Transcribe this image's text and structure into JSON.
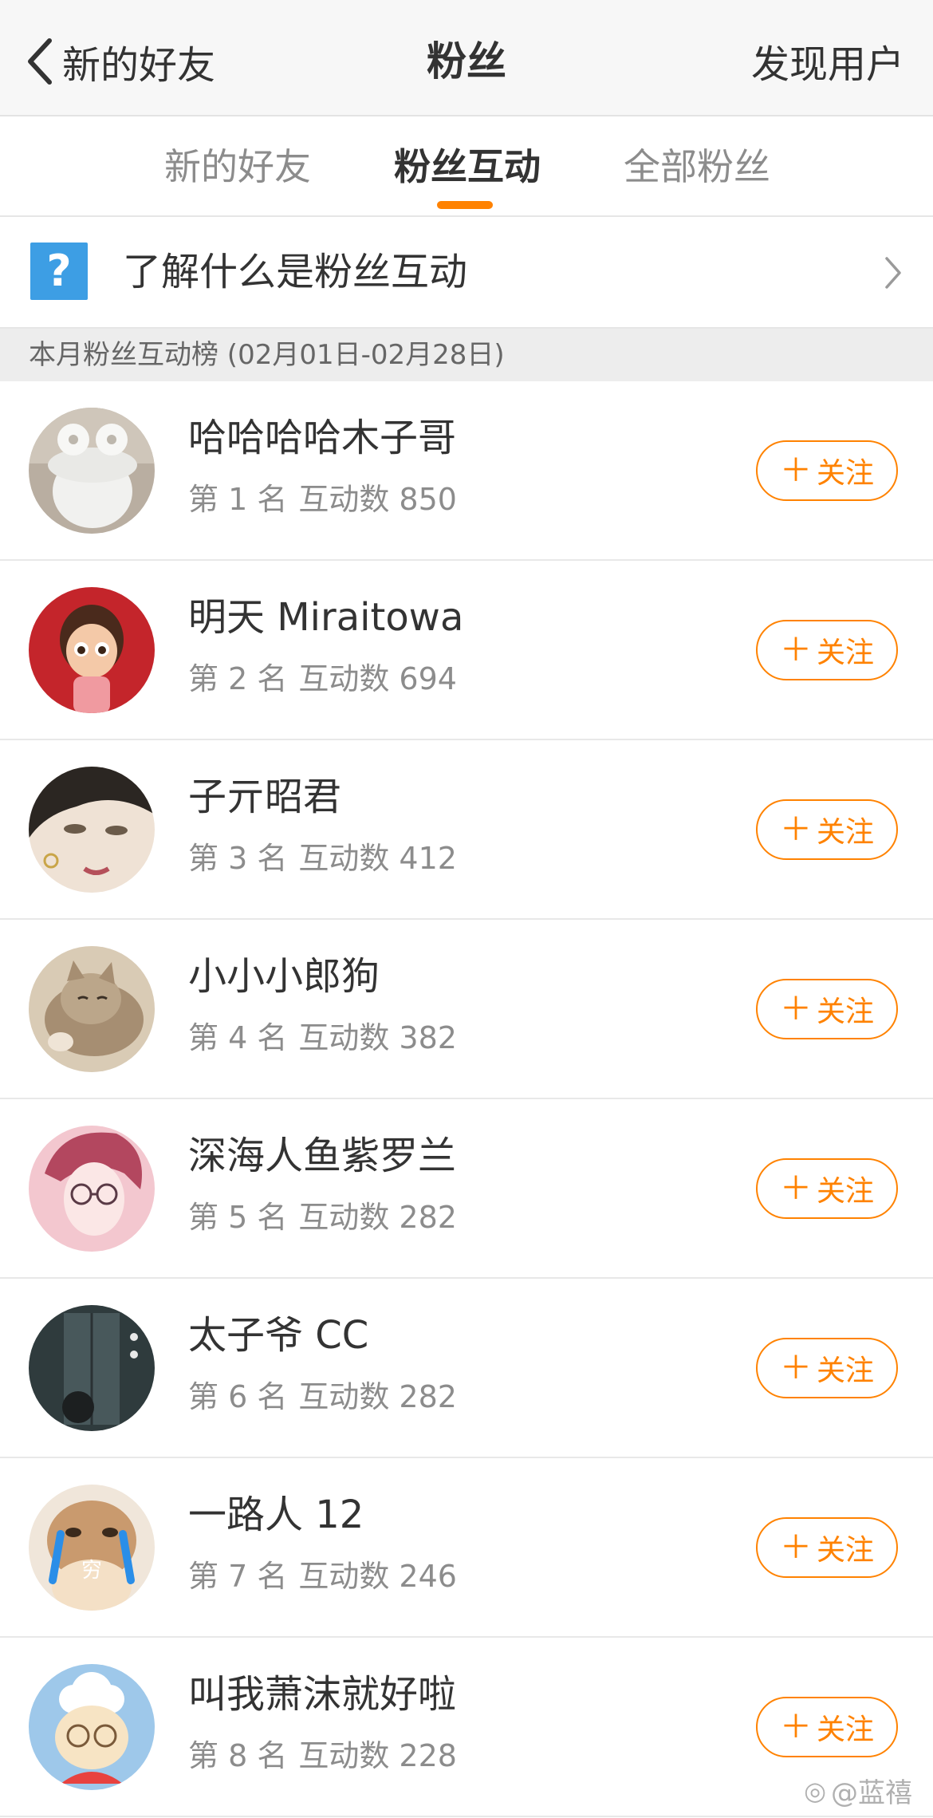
{
  "nav": {
    "back_label": "新的好友",
    "title": "粉丝",
    "right_label": "发现用户"
  },
  "tabs": [
    {
      "label": "新的好友",
      "active": false
    },
    {
      "label": "粉丝互动",
      "active": true
    },
    {
      "label": "全部粉丝",
      "active": false
    }
  ],
  "info": {
    "icon_text": "?",
    "text": "了解什么是粉丝互动"
  },
  "section_header": "本月粉丝互动榜 (02月01日-02月28日)",
  "follow_label": "关注",
  "colors": {
    "accent": "#ff8200",
    "question_icon_bg": "#3d9ee4",
    "section_bg": "#ededed"
  },
  "fans": [
    {
      "name": "哈哈哈哈木子哥",
      "rank": "第 1 名",
      "interactions": "互动数 850",
      "avatar": "toilet-avatar"
    },
    {
      "name": "明天 Miraitowa",
      "rank": "第 2 名",
      "interactions": "互动数 694",
      "avatar": "cartoon-girl-avatar"
    },
    {
      "name": "子亓昭君",
      "rank": "第 3 名",
      "interactions": "互动数 412",
      "avatar": "illustrated-face-avatar"
    },
    {
      "name": "小小小郎狗",
      "rank": "第 4 名",
      "interactions": "互动数 382",
      "avatar": "cat-avatar"
    },
    {
      "name": "深海人鱼紫罗兰",
      "rank": "第 5 名",
      "interactions": "互动数 282",
      "avatar": "anime-boy-avatar"
    },
    {
      "name": "太子爷 CC",
      "rank": "第 6 名",
      "interactions": "互动数 282",
      "avatar": "elevator-avatar"
    },
    {
      "name": "一路人 12",
      "rank": "第 7 名",
      "interactions": "互动数 246",
      "avatar": "crying-cat-avatar",
      "avatar_text": "穷"
    },
    {
      "name": "叫我萧沫就好啦",
      "rank": "第 8 名",
      "interactions": "互动数 228",
      "avatar": "sheep-avatar"
    }
  ],
  "watermark": "@蓝禧"
}
